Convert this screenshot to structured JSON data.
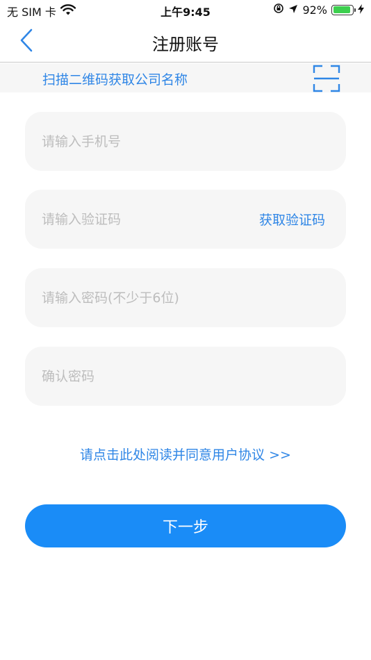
{
  "status_bar": {
    "carrier": "无 SIM 卡",
    "time": "上午9:45",
    "battery_percent": "92%",
    "battery_level": 0.92,
    "icons": [
      "wifi-icon",
      "orientation-lock-icon",
      "location-arrow-icon",
      "battery-icon",
      "charging-bolt-icon"
    ]
  },
  "nav": {
    "title": "注册账号",
    "back_icon": "chevron-left-icon"
  },
  "scan": {
    "label": "扫描二维码获取公司名称",
    "icon": "scan-frame-icon"
  },
  "form": {
    "phone_placeholder": "请输入手机号",
    "phone_value": "",
    "code_placeholder": "请输入验证码",
    "code_value": "",
    "get_code_label": "获取验证码",
    "password_placeholder": "请输入密码(不少于6位)",
    "password_value": "",
    "confirm_placeholder": "确认密码",
    "confirm_value": ""
  },
  "agreement": {
    "text": "请点击此处阅读并同意用户协议 >>"
  },
  "next_button": {
    "label": "下一步"
  },
  "colors": {
    "accent": "#2f86e6",
    "button": "#1a8cf7",
    "field_bg": "#f6f6f6",
    "placeholder": "#bdbdbd",
    "battery": "#3ccf4e"
  }
}
